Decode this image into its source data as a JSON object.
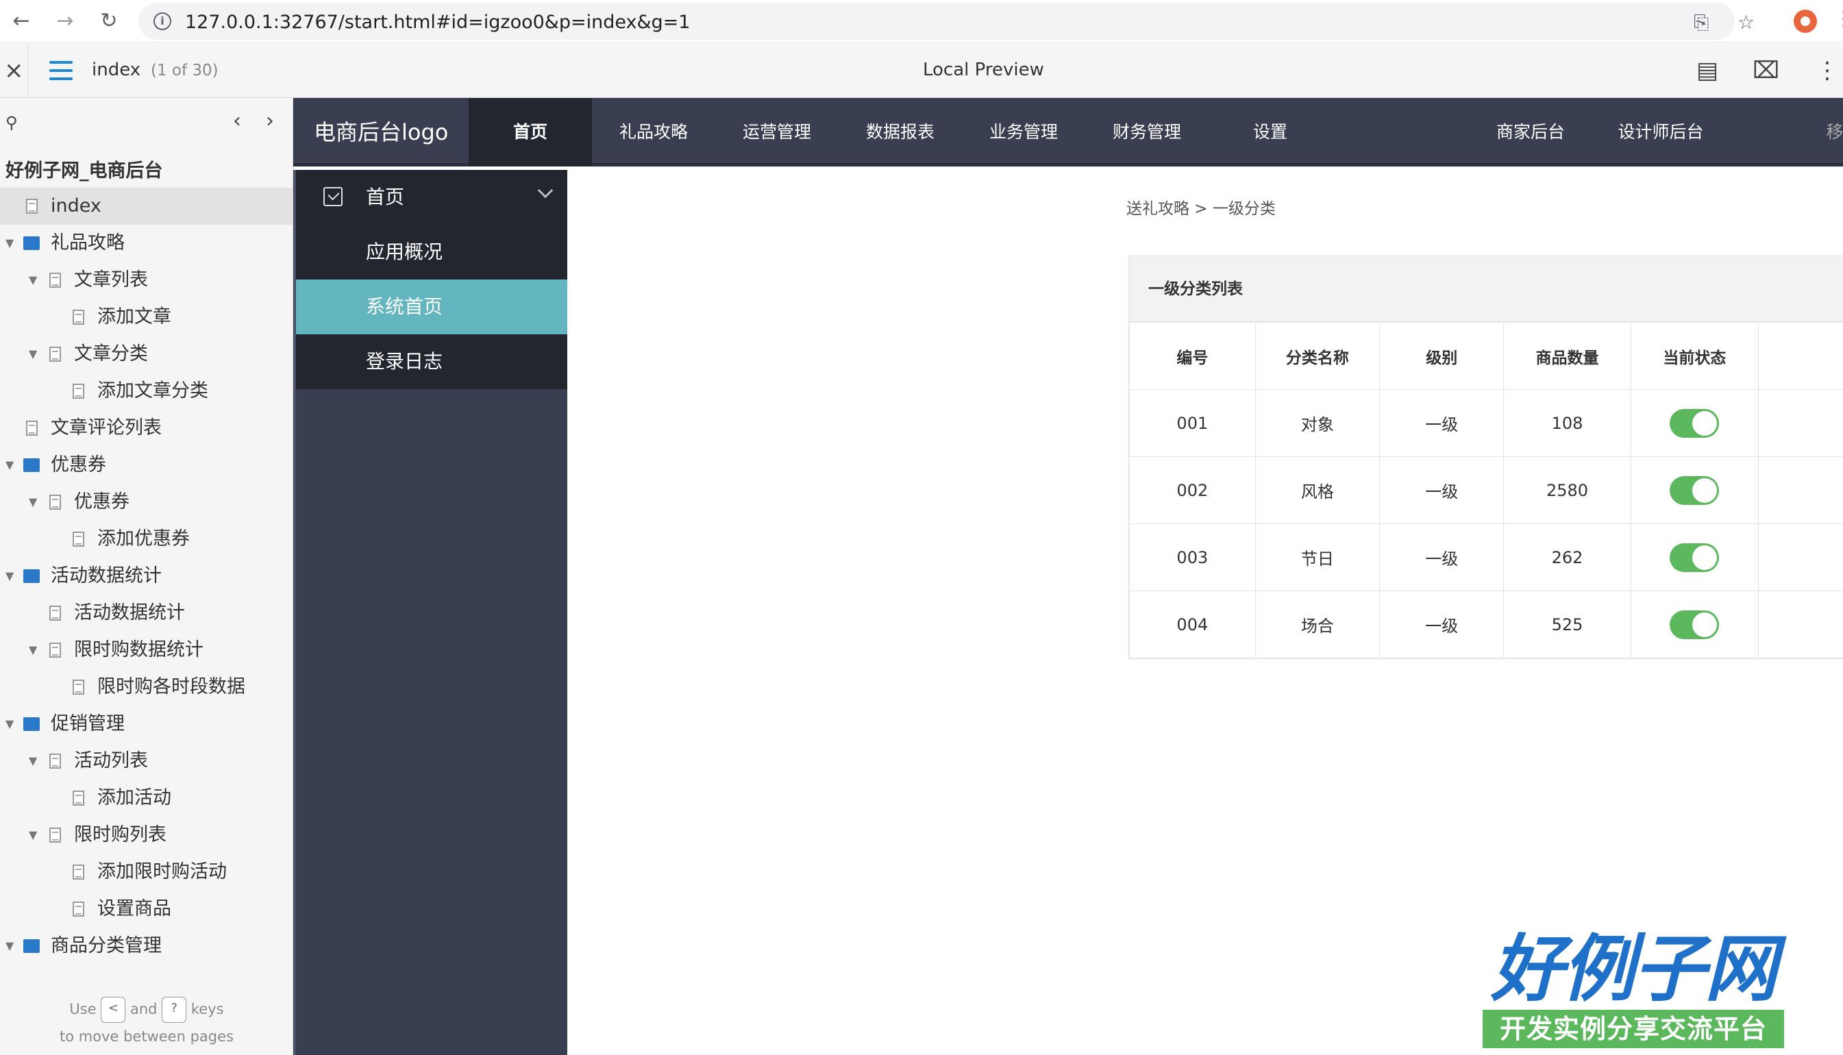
{
  "browser": {
    "url": "127.0.0.1:32767/start.html#id=igzoo0&p=index&g=1"
  },
  "toolbar": {
    "page_name": "index",
    "page_count": "(1 of 30)",
    "title": "Local Preview"
  },
  "tree": {
    "project": "好例子网_电商后台",
    "items": [
      {
        "label": "index",
        "type": "page",
        "level": 0,
        "selected": true
      },
      {
        "label": "礼品攻略",
        "type": "folder",
        "level": 0
      },
      {
        "label": "文章列表",
        "type": "page",
        "level": 1,
        "expanded": true
      },
      {
        "label": "添加文章",
        "type": "page",
        "level": 2
      },
      {
        "label": "文章分类",
        "type": "page",
        "level": 1,
        "expanded": true
      },
      {
        "label": "添加文章分类",
        "type": "page",
        "level": 2
      },
      {
        "label": "文章评论列表",
        "type": "page",
        "level": 0
      },
      {
        "label": "优惠券",
        "type": "folder",
        "level": 0
      },
      {
        "label": "优惠券",
        "type": "page",
        "level": 1,
        "expanded": true
      },
      {
        "label": "添加优惠券",
        "type": "page",
        "level": 2
      },
      {
        "label": "活动数据统计",
        "type": "folder",
        "level": 0
      },
      {
        "label": "活动数据统计",
        "type": "page",
        "level": 1
      },
      {
        "label": "限时购数据统计",
        "type": "page",
        "level": 1,
        "expanded": true
      },
      {
        "label": "限时购各时段数据",
        "type": "page",
        "level": 2
      },
      {
        "label": "促销管理",
        "type": "folder",
        "level": 0
      },
      {
        "label": "活动列表",
        "type": "page",
        "level": 1,
        "expanded": true
      },
      {
        "label": "添加活动",
        "type": "page",
        "level": 2
      },
      {
        "label": "限时购列表",
        "type": "page",
        "level": 1,
        "expanded": true
      },
      {
        "label": "添加限时购活动",
        "type": "page",
        "level": 2
      },
      {
        "label": "设置商品",
        "type": "page",
        "level": 2
      },
      {
        "label": "商品分类管理",
        "type": "folder",
        "level": 0
      }
    ],
    "hint_use": "Use",
    "hint_and": "and",
    "hint_keys": "keys",
    "hint_line2": "to move between pages"
  },
  "app": {
    "logo": "电商后台logo",
    "nav": [
      "首页",
      "礼品攻略",
      "运营管理",
      "数据报表",
      "业务管理",
      "财务管理",
      "设置",
      "商家后台",
      "设计师后台"
    ],
    "nav_cut": "移",
    "side": {
      "head": "首页",
      "items": [
        "应用概况",
        "系统首页",
        "登录日志"
      ]
    },
    "breadcrumb": "送礼攻略 > 一级分类",
    "table": {
      "title": "一级分类列表",
      "headers": [
        "编号",
        "分类名称",
        "级别",
        "商品数量",
        "当前状态"
      ],
      "rows": [
        {
          "id": "001",
          "name": "对象",
          "level": "一级",
          "count": "108",
          "status": "on"
        },
        {
          "id": "002",
          "name": "风格",
          "level": "一级",
          "count": "2580",
          "status": "on"
        },
        {
          "id": "003",
          "name": "节日",
          "level": "一级",
          "count": "262",
          "status": "on"
        },
        {
          "id": "004",
          "name": "场合",
          "level": "一级",
          "count": "525",
          "status": "on"
        }
      ]
    }
  },
  "watermark": {
    "title": "好例子网",
    "subtitle": "开发实例分享交流平台"
  },
  "colors": {
    "nav_bg": "#3a3e51",
    "nav_active": "#23262f",
    "side_active": "#63b6c0",
    "toggle_on": "#5cb85c",
    "folder_icon": "#2a79c8"
  }
}
